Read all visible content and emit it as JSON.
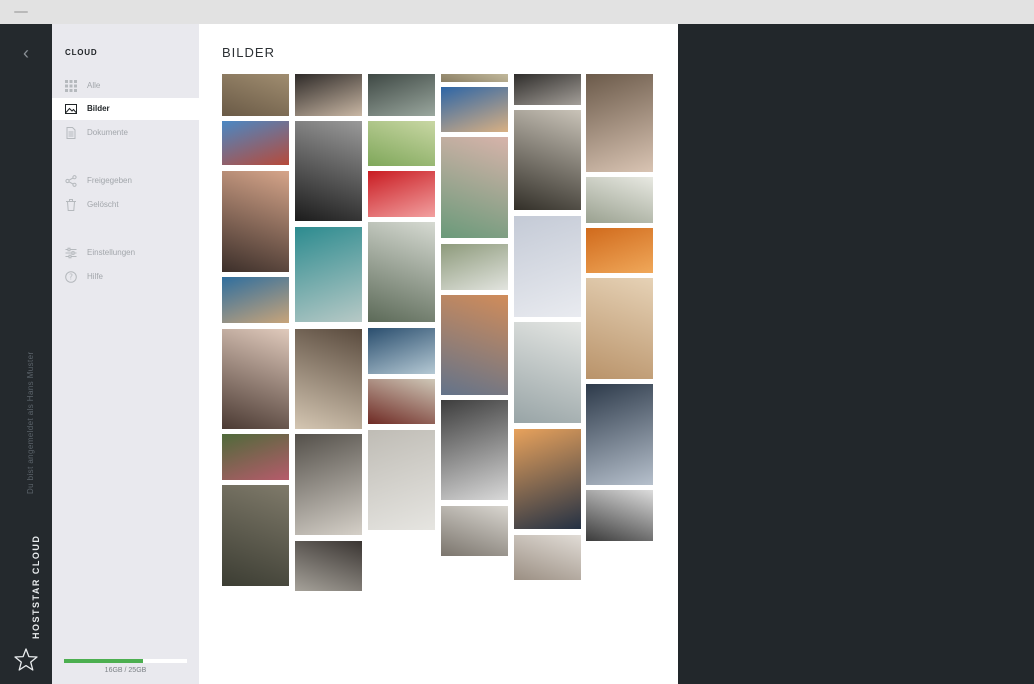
{
  "window": {
    "title": ""
  },
  "rail": {
    "back_icon": "chevron-left-icon",
    "user_text": "Du bist angemeldet als Hans Muster",
    "brand": "HOSTSTAR CLOUD",
    "logo_icon": "star-icon"
  },
  "sidebar": {
    "heading": "CLOUD",
    "items": [
      {
        "label": "Alle",
        "icon": "grid-icon",
        "active": false
      },
      {
        "label": "Bilder",
        "icon": "image-icon",
        "active": true
      },
      {
        "label": "Dokumente",
        "icon": "document-icon",
        "active": false
      },
      {
        "label": "Freigegeben",
        "icon": "share-icon",
        "active": false
      },
      {
        "label": "Gelöscht",
        "icon": "trash-icon",
        "active": false
      },
      {
        "label": "Einstellungen",
        "icon": "sliders-icon",
        "active": false
      },
      {
        "label": "Hilfe",
        "icon": "help-icon",
        "active": false
      }
    ],
    "storage": {
      "text": "16GB / 25GB",
      "used": 16,
      "total": 25
    }
  },
  "main": {
    "title": "BILDER"
  },
  "colors": {
    "rail": "#24292d",
    "sidebar": "#e9e9ee",
    "accent": "#4caf50",
    "panel": "#22272b"
  }
}
